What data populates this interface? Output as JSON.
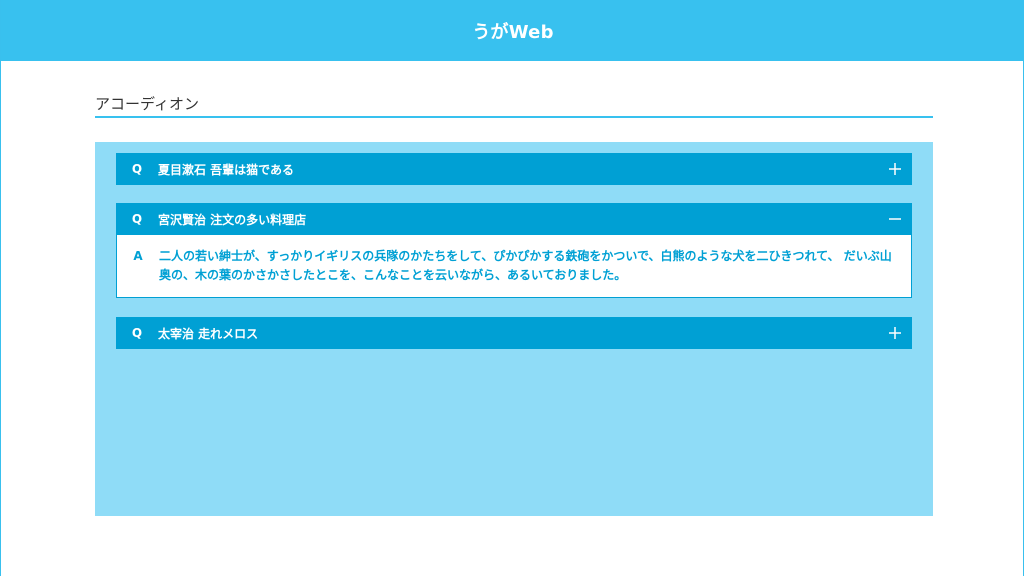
{
  "header": {
    "title": "うがWeb"
  },
  "section": {
    "heading": "アコーディオン"
  },
  "accordion": {
    "q_marker": "Q",
    "a_marker": "A",
    "items": [
      {
        "question": "夏目漱石 吾輩は猫である",
        "expanded": false,
        "toggle_icon": "plus-icon"
      },
      {
        "question": "宮沢賢治 注文の多い料理店",
        "expanded": true,
        "toggle_icon": "minus-icon",
        "answer": "二人の若い紳士が、すっかりイギリスの兵隊のかたちをして、ぴかぴかする鉄砲をかついで、白熊のような犬を二ひきつれて、 だいぶ山奥の、木の葉のかさかさしたとこを、こんなことを云いながら、あるいておりました。"
      },
      {
        "question": "太宰治 走れメロス",
        "expanded": false,
        "toggle_icon": "plus-icon"
      }
    ]
  },
  "colors": {
    "header_bg": "#38c1ef",
    "panel_bg": "#8fdcf7",
    "question_bg": "#00a0d4",
    "answer_text": "#00a0d4"
  }
}
